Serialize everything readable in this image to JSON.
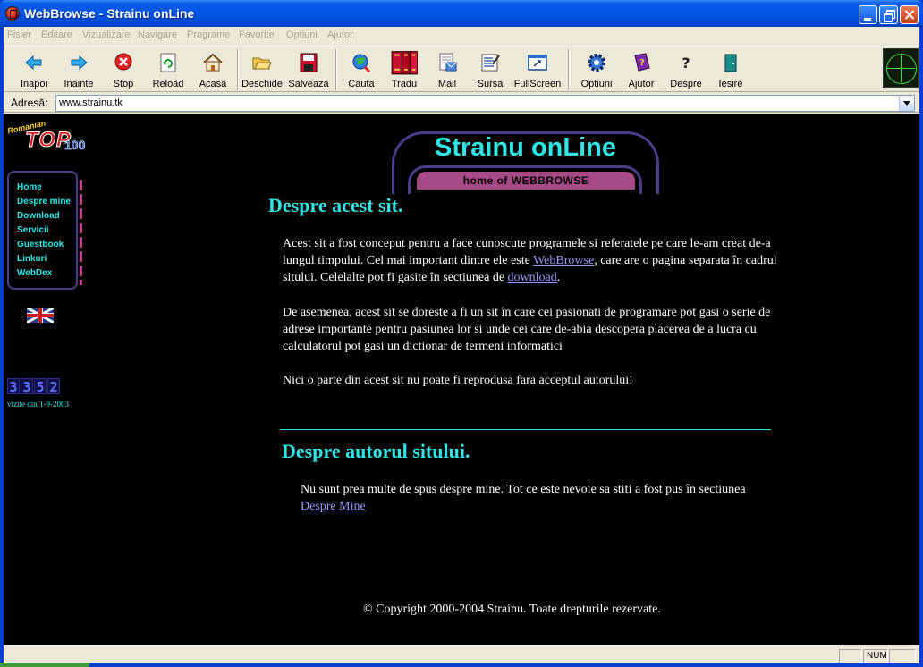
{
  "window": {
    "title": "WebBrowse - Strainu onLine"
  },
  "menubar": {
    "items": [
      "Fisier",
      "Editare",
      "Vizualizare",
      "Navigare",
      "Programe",
      "Favorite",
      "Optiuni",
      "Ajutor"
    ]
  },
  "toolbar": {
    "buttons": [
      {
        "label": "Inapoi",
        "icon": "back-arrow-icon"
      },
      {
        "label": "Inainte",
        "icon": "forward-arrow-icon"
      },
      {
        "label": "Stop",
        "icon": "stop-icon"
      },
      {
        "label": "Reload",
        "icon": "reload-icon"
      },
      {
        "label": "Acasa",
        "icon": "home-icon"
      },
      {
        "label": "Deschide",
        "icon": "open-folder-icon"
      },
      {
        "label": "Salveaza",
        "icon": "save-disk-icon"
      },
      {
        "label": "Cauta",
        "icon": "search-globe-icon"
      },
      {
        "label": "Tradu",
        "icon": "books-icon"
      },
      {
        "label": "Mail",
        "icon": "mail-icon"
      },
      {
        "label": "Sursa",
        "icon": "source-icon"
      },
      {
        "label": "FullScreen",
        "icon": "fullscreen-icon"
      },
      {
        "label": "Optiuni",
        "icon": "options-gear-icon"
      },
      {
        "label": "Ajutor",
        "icon": "help-book-icon"
      },
      {
        "label": "Despre",
        "icon": "question-icon"
      },
      {
        "label": "Iesire",
        "icon": "exit-door-icon"
      }
    ]
  },
  "address": {
    "label": "Adresă:",
    "value": "www.strainu.tk"
  },
  "page": {
    "top100": {
      "ribbon": "Romanian",
      "main": "TOP",
      "number": "100"
    },
    "nav": [
      "Home",
      "Despre mine",
      "Download",
      "Servicii",
      "Guestbook",
      "Linkuri",
      "WebDex"
    ],
    "counter": {
      "digits": [
        "3",
        "3",
        "5",
        "2"
      ],
      "caption": "vizite din 1-9-2003"
    },
    "logo": {
      "title": "Strainu onLine",
      "subtitle": "home of WEBBROWSE"
    },
    "section1": {
      "heading": "Despre acest sit.",
      "p1_a": "Acest sit a fost conceput pentru a face cunoscute programele si referatele pe care le-am creat de-a lungul timpului. Cel mai important dintre ele este ",
      "p1_link1": "WebBrowse",
      "p1_b": ", care are o pagina separata în cadrul sitului. Celelalte pot fi gasite în sectiunea de ",
      "p1_link2": "download",
      "p1_c": ".",
      "p2": "De asemenea, acest sit se doreste a fi un sit în care cei pasionati de programare pot gasi o serie de adrese importante pentru pasiunea lor si unde cei care de-abia descopera placerea de a lucra cu calculatorul pot gasi un dictionar de termeni informatici",
      "p3": "Nici o parte din acest sit nu poate fi reprodusa fara acceptul autorului!"
    },
    "section2": {
      "heading": "Despre autorul sitului.",
      "p_a": "Nu sunt prea multe de spus despre mine. Tot ce este nevoie sa stiti a fost pus în sectiunea ",
      "p_link": "Despre Mine"
    },
    "copyright": "© Copyright 2000-2004 Strainu. Toate drepturile rezervate."
  },
  "statusbar": {
    "text": "",
    "panels": [
      "",
      "NUM",
      ""
    ]
  }
}
